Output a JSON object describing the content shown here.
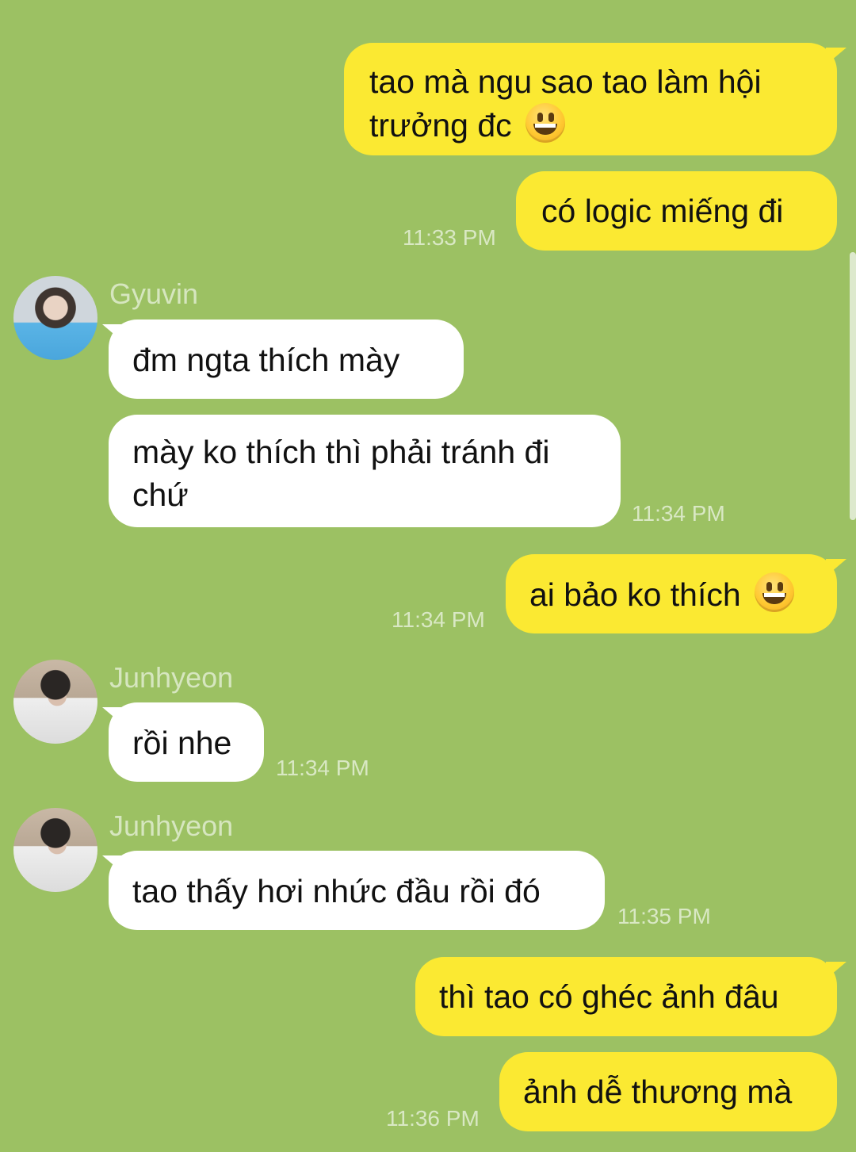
{
  "colors": {
    "background": "#9cc163",
    "outgoing": "#fbe932",
    "incoming": "#ffffff",
    "meta_text": "#d9e8c4"
  },
  "messages": {
    "m1": {
      "text": "tao mà ngu sao tao làm hội trưởng đc",
      "emoji": "grinning-face-emoji"
    },
    "m2": {
      "text": "có logic miếng đi",
      "time": "11:33 PM"
    },
    "m3": {
      "sender": "Gyuvin",
      "text": "đm ngta thích mày"
    },
    "m4": {
      "text": "mày ko thích thì phải tránh đi chứ",
      "time": "11:34 PM"
    },
    "m5": {
      "text": "ai bảo ko thích",
      "emoji": "grinning-face-emoji",
      "time": "11:34 PM"
    },
    "m6": {
      "sender": "Junhyeon",
      "text": "rồi nhe",
      "time": "11:34 PM"
    },
    "m7": {
      "sender": "Junhyeon",
      "text": "tao thấy hơi nhức đầu rồi đó",
      "time": "11:35 PM"
    },
    "m8": {
      "text": "thì tao có ghéc ảnh đâu"
    },
    "m9": {
      "text": "ảnh dễ thương mà",
      "time": "11:36 PM"
    }
  }
}
